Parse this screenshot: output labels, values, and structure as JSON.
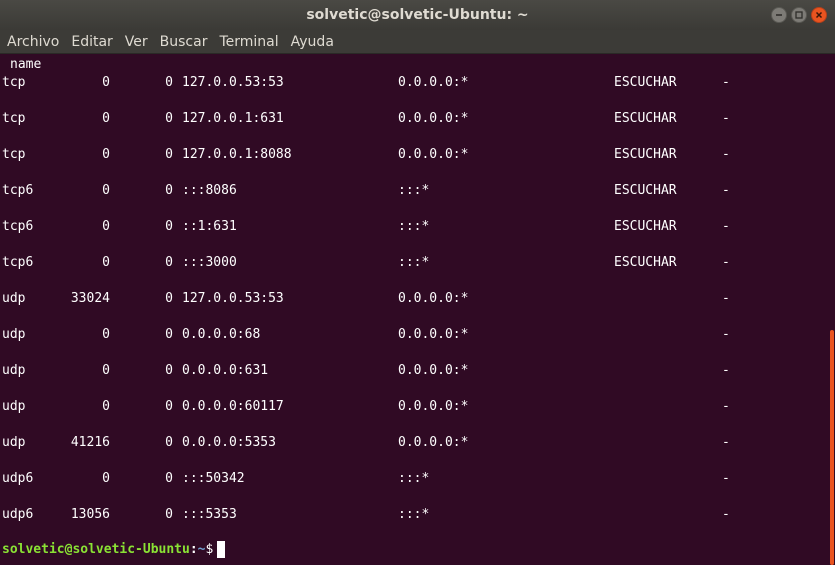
{
  "window": {
    "title": "solvetic@solvetic-Ubuntu: ~"
  },
  "menu": {
    "items": [
      "Archivo",
      "Editar",
      "Ver",
      "Buscar",
      "Terminal",
      "Ayuda"
    ]
  },
  "terminal": {
    "header_fragment": "name",
    "rows": [
      {
        "proto": "tcp",
        "recvq": "0",
        "sendq": "0",
        "local": "127.0.0.53:53",
        "foreign": "0.0.0.0:*",
        "state": "ESCUCHAR",
        "program": "-"
      },
      {
        "proto": "tcp",
        "recvq": "0",
        "sendq": "0",
        "local": "127.0.0.1:631",
        "foreign": "0.0.0.0:*",
        "state": "ESCUCHAR",
        "program": "-"
      },
      {
        "proto": "tcp",
        "recvq": "0",
        "sendq": "0",
        "local": "127.0.0.1:8088",
        "foreign": "0.0.0.0:*",
        "state": "ESCUCHAR",
        "program": "-"
      },
      {
        "proto": "tcp6",
        "recvq": "0",
        "sendq": "0",
        "local": ":::8086",
        "foreign": ":::*",
        "state": "ESCUCHAR",
        "program": "-"
      },
      {
        "proto": "tcp6",
        "recvq": "0",
        "sendq": "0",
        "local": "::1:631",
        "foreign": ":::*",
        "state": "ESCUCHAR",
        "program": "-"
      },
      {
        "proto": "tcp6",
        "recvq": "0",
        "sendq": "0",
        "local": ":::3000",
        "foreign": ":::*",
        "state": "ESCUCHAR",
        "program": "-"
      },
      {
        "proto": "udp",
        "recvq": "33024",
        "sendq": "0",
        "local": "127.0.0.53:53",
        "foreign": "0.0.0.0:*",
        "state": "",
        "program": "-"
      },
      {
        "proto": "udp",
        "recvq": "0",
        "sendq": "0",
        "local": "0.0.0.0:68",
        "foreign": "0.0.0.0:*",
        "state": "",
        "program": "-"
      },
      {
        "proto": "udp",
        "recvq": "0",
        "sendq": "0",
        "local": "0.0.0.0:631",
        "foreign": "0.0.0.0:*",
        "state": "",
        "program": "-"
      },
      {
        "proto": "udp",
        "recvq": "0",
        "sendq": "0",
        "local": "0.0.0.0:60117",
        "foreign": "0.0.0.0:*",
        "state": "",
        "program": "-"
      },
      {
        "proto": "udp",
        "recvq": "41216",
        "sendq": "0",
        "local": "0.0.0.0:5353",
        "foreign": "0.0.0.0:*",
        "state": "",
        "program": "-"
      },
      {
        "proto": "udp6",
        "recvq": "0",
        "sendq": "0",
        "local": ":::50342",
        "foreign": ":::*",
        "state": "",
        "program": "-"
      },
      {
        "proto": "udp6",
        "recvq": "13056",
        "sendq": "0",
        "local": ":::5353",
        "foreign": ":::*",
        "state": "",
        "program": "-"
      }
    ],
    "prompt": {
      "user_host": "solvetic@solvetic-Ubuntu",
      "colon": ":",
      "path": "~",
      "symbol": "$"
    }
  },
  "colors": {
    "terminal_bg": "#300a24",
    "prompt_user": "#8ae234",
    "prompt_path": "#729fcf",
    "accent": "#e95420"
  }
}
